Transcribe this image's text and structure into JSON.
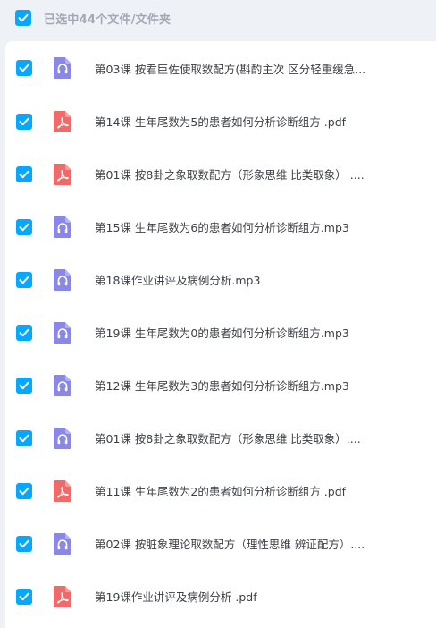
{
  "selection": {
    "label": "已选中44个文件/文件夹",
    "checked": true
  },
  "colors": {
    "checkbox": "#06a7ff",
    "audio_icon": "#8b87e6",
    "pdf_icon": "#f06a6a",
    "text": "#3d3f45",
    "muted": "#a3a8b3"
  },
  "files": [
    {
      "name": "第03课 按君臣佐使取数配方(斟酌主次 区分轻重缓急...",
      "type": "audio",
      "icon": "headphones-icon",
      "checked": true
    },
    {
      "name": "第14课 生年尾数为5的患者如何分析诊断组方 .pdf",
      "type": "pdf",
      "icon": "pdf-icon",
      "checked": true
    },
    {
      "name": "第01课 按8卦之象取数配方（形象思维 比类取象） ....",
      "type": "pdf",
      "icon": "pdf-icon",
      "checked": true
    },
    {
      "name": "第15课 生年尾数为6的患者如何分析诊断组方.mp3",
      "type": "audio",
      "icon": "headphones-icon",
      "checked": true
    },
    {
      "name": "第18课作业讲评及病例分析.mp3",
      "type": "audio",
      "icon": "headphones-icon",
      "checked": true
    },
    {
      "name": "第19课 生年尾数为0的患者如何分析诊断组方.mp3",
      "type": "audio",
      "icon": "headphones-icon",
      "checked": true
    },
    {
      "name": "第12课 生年尾数为3的患者如何分析诊断组方.mp3",
      "type": "audio",
      "icon": "headphones-icon",
      "checked": true
    },
    {
      "name": "第01课 按8卦之象取数配方（形象思维 比类取象）....",
      "type": "audio",
      "icon": "headphones-icon",
      "checked": true
    },
    {
      "name": "第11课 生年尾数为2的患者如何分析诊断组方 .pdf",
      "type": "pdf",
      "icon": "pdf-icon",
      "checked": true
    },
    {
      "name": "第02课 按脏象理论取数配方（理性思维 辨证配方）....",
      "type": "audio",
      "icon": "headphones-icon",
      "checked": true
    },
    {
      "name": "第19课作业讲评及病例分析 .pdf",
      "type": "pdf",
      "icon": "pdf-icon",
      "checked": true
    }
  ]
}
